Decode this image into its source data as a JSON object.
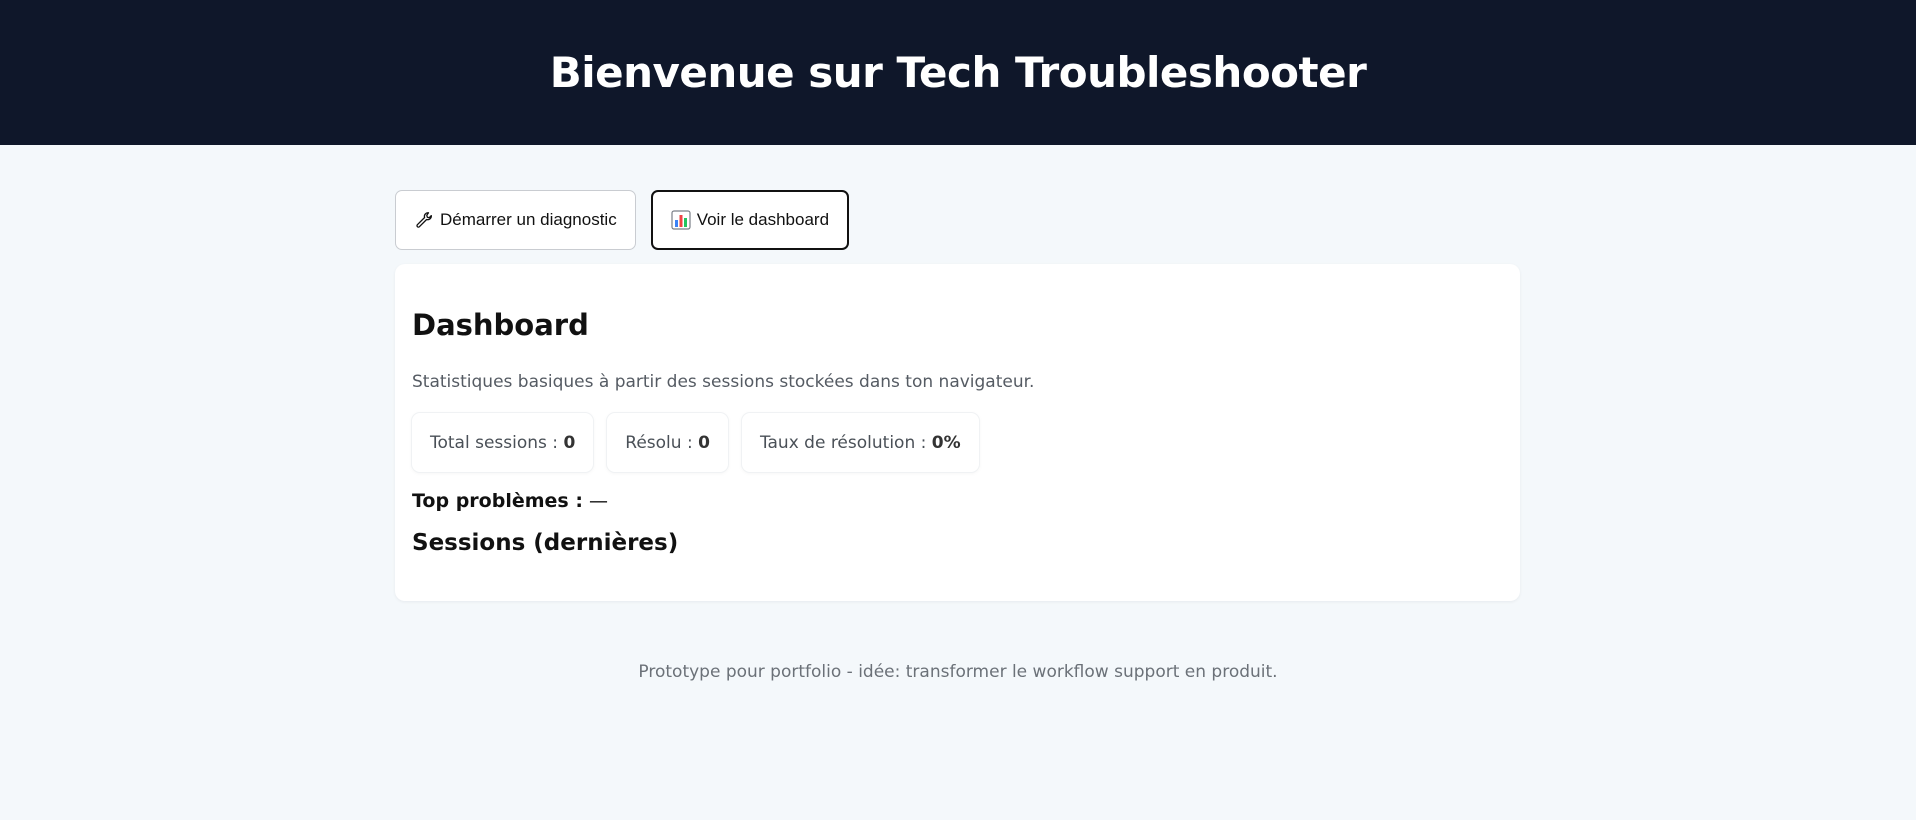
{
  "header": {
    "title": "Bienvenue sur Tech Troubleshooter"
  },
  "nav": {
    "diagnostic_button": {
      "label": "Démarrer un diagnostic",
      "icon": "wrench-icon"
    },
    "dashboard_button": {
      "label": "Voir le dashboard",
      "icon": "bar-chart-icon",
      "active": true
    }
  },
  "dashboard": {
    "title": "Dashboard",
    "description": "Statistiques basiques à partir des sessions stockées dans ton navigateur.",
    "stats": [
      {
        "label": "Total sessions : ",
        "value": "0"
      },
      {
        "label": "Résolu : ",
        "value": "0"
      },
      {
        "label": "Taux de résolution : ",
        "value": "0%"
      }
    ],
    "top_problems_label": "Top problèmes :",
    "top_problems_value": " —",
    "sessions_title": "Sessions (dernières)"
  },
  "footer": {
    "text": "Prototype pour portfolio - idée: transformer le workflow support en produit."
  },
  "colors": {
    "header_bg": "#0f172a",
    "page_bg": "#f4f8fb",
    "card_bg": "#ffffff"
  }
}
